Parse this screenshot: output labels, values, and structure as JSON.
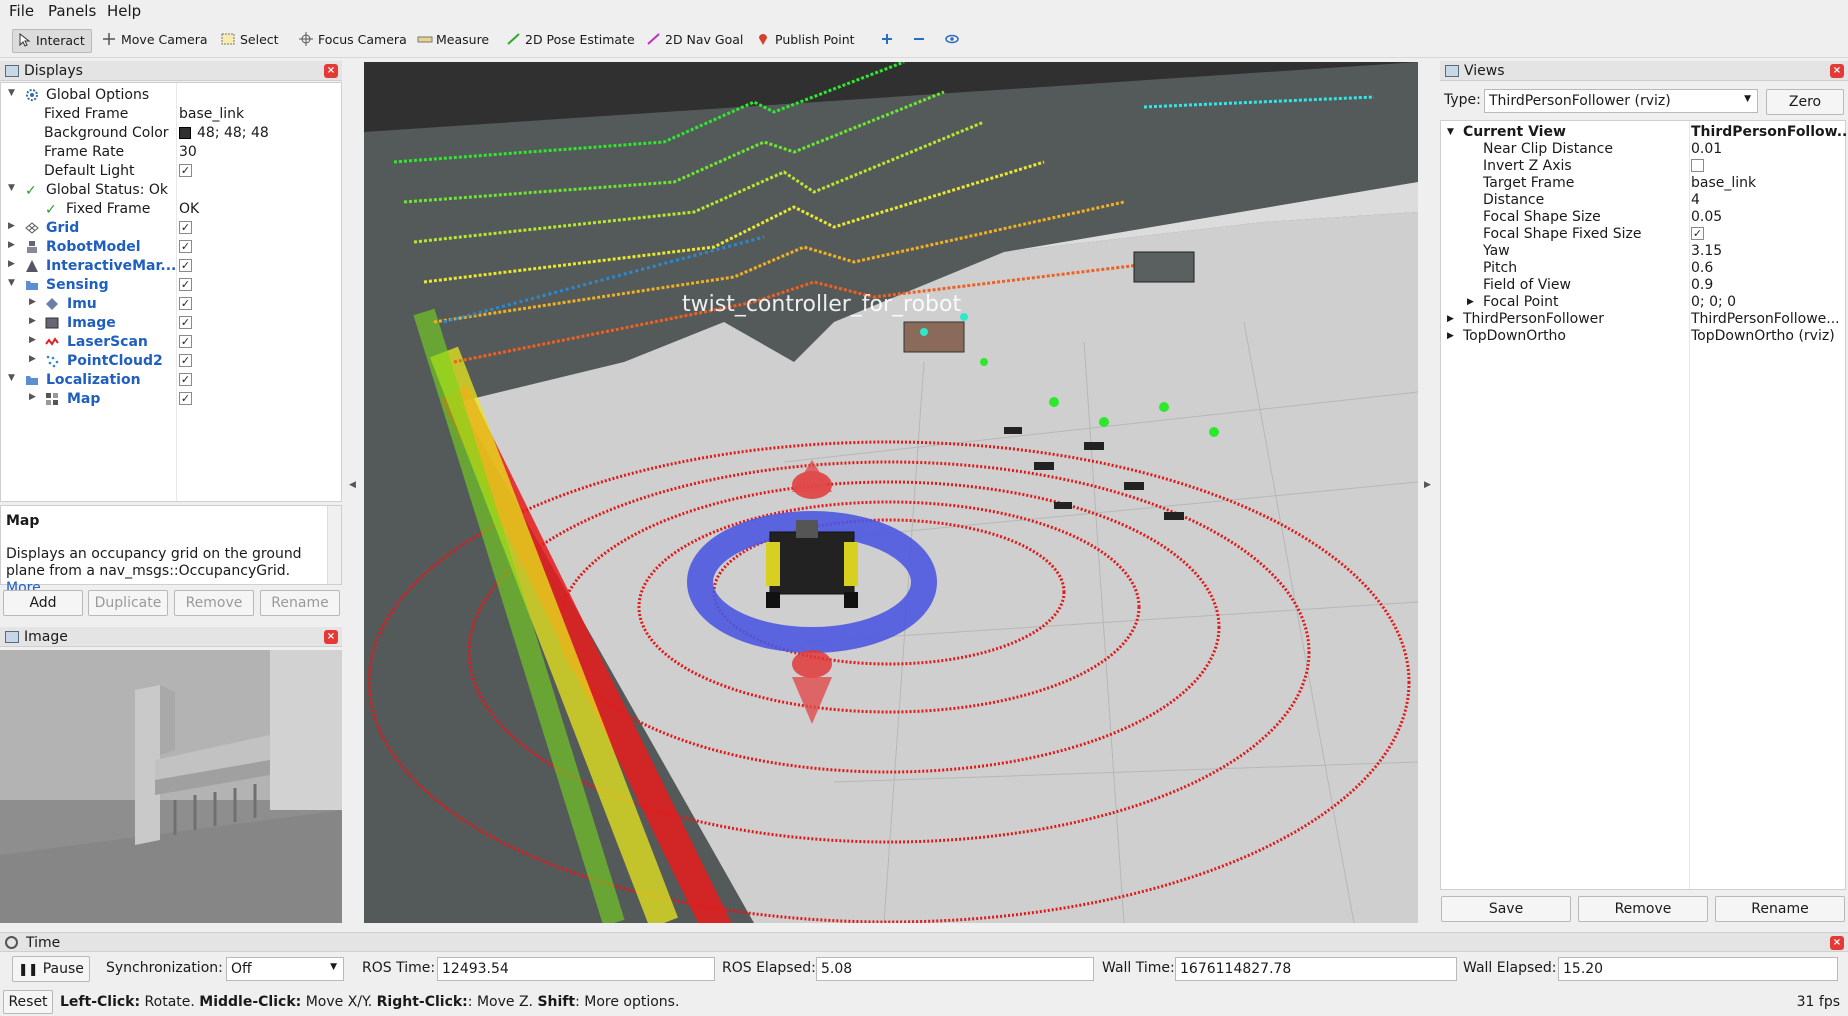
{
  "menu": [
    "File",
    "Panels",
    "Help"
  ],
  "toolbar": {
    "tools": [
      "Interact",
      "Move Camera",
      "Select",
      "Focus Camera",
      "Measure",
      "2D Pose Estimate",
      "2D Nav Goal",
      "Publish Point"
    ]
  },
  "displays": {
    "title": "Displays",
    "rows": [
      {
        "label": "Global Options",
        "value": ""
      },
      {
        "label": "Fixed Frame",
        "value": "base_link"
      },
      {
        "label": "Background Color",
        "value": "48; 48; 48"
      },
      {
        "label": "Frame Rate",
        "value": "30"
      },
      {
        "label": "Default Light",
        "value": ""
      },
      {
        "label": "Global Status: Ok",
        "value": ""
      },
      {
        "label": "Fixed Frame",
        "value": "OK"
      },
      {
        "label": "Grid",
        "value": ""
      },
      {
        "label": "RobotModel",
        "value": ""
      },
      {
        "label": "InteractiveMar...",
        "value": ""
      },
      {
        "label": "Sensing",
        "value": ""
      },
      {
        "label": "Imu",
        "value": ""
      },
      {
        "label": "Image",
        "value": ""
      },
      {
        "label": "LaserScan",
        "value": ""
      },
      {
        "label": "PointCloud2",
        "value": ""
      },
      {
        "label": "Localization",
        "value": ""
      },
      {
        "label": "Map",
        "value": ""
      }
    ],
    "bg_color_hex": "#303030"
  },
  "description": {
    "title": "Map",
    "text": "Displays an occupancy grid on the ground plane from a nav_msgs::OccupancyGrid.",
    "more": "More"
  },
  "display_buttons": [
    "Add",
    "Duplicate",
    "Remove",
    "Rename"
  ],
  "image_panel": {
    "title": "Image"
  },
  "view3d": {
    "overlay_text": "twist_controller_for_robot"
  },
  "views": {
    "title": "Views",
    "type_label": "Type:",
    "type_value": "ThirdPersonFollower (rviz)",
    "zero_label": "Zero",
    "rows": [
      {
        "label": "Current View",
        "value": "ThirdPersonFollow..."
      },
      {
        "label": "Near Clip Distance",
        "value": "0.01"
      },
      {
        "label": "Invert Z Axis",
        "value": ""
      },
      {
        "label": "Target Frame",
        "value": "base_link"
      },
      {
        "label": "Distance",
        "value": "4"
      },
      {
        "label": "Focal Shape Size",
        "value": "0.05"
      },
      {
        "label": "Focal Shape Fixed Size",
        "value": ""
      },
      {
        "label": "Yaw",
        "value": "3.15"
      },
      {
        "label": "Pitch",
        "value": "0.6"
      },
      {
        "label": "Field of View",
        "value": "0.9"
      },
      {
        "label": "Focal Point",
        "value": "0; 0; 0"
      },
      {
        "label": "ThirdPersonFollower",
        "value": "ThirdPersonFollowe..."
      },
      {
        "label": "TopDownOrtho",
        "value": "TopDownOrtho (rviz)"
      }
    ],
    "buttons": [
      "Save",
      "Remove",
      "Rename"
    ]
  },
  "time": {
    "title": "Time",
    "pause_label": "Pause",
    "sync_label": "Synchronization:",
    "sync_value": "Off",
    "ros_time_label": "ROS Time:",
    "ros_time": "12493.54",
    "ros_elapsed_label": "ROS Elapsed:",
    "ros_elapsed": "5.08",
    "wall_time_label": "Wall Time:",
    "wall_time": "1676114827.78",
    "wall_elapsed_label": "Wall Elapsed:",
    "wall_elapsed": "15.20"
  },
  "status": {
    "reset_label": "Reset",
    "left_click": "Left-Click:",
    "left_click_text": " Rotate. ",
    "middle_click": "Middle-Click:",
    "middle_click_text": " Move X/Y. ",
    "right_click": "Right-Click:",
    "right_click_text": ": Move Z. ",
    "shift": "Shift",
    "shift_text": ": More options.",
    "fps": "31 fps"
  }
}
